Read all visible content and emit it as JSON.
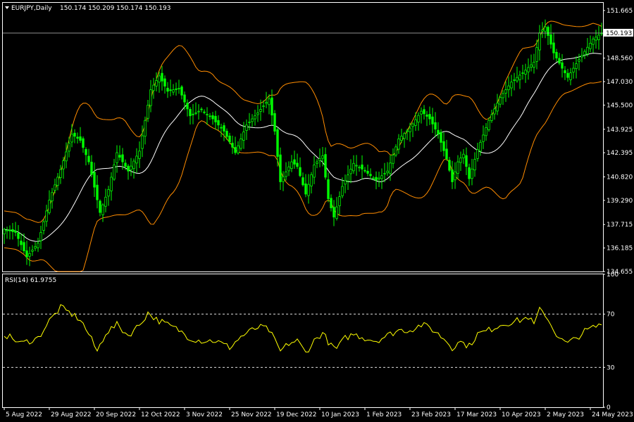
{
  "header": {
    "symbol_label": "EURJPY,Daily",
    "ohlc_text": "150.174 150.209 150.174 150.193"
  },
  "colors": {
    "background": "#000000",
    "grid": "#ffffff",
    "candle": "#00ff00",
    "bollinger": "#ff8c00",
    "sma": "#ffffff",
    "rsi": "#ffff00",
    "last_price_line": "#c0c0c0"
  },
  "chart_data": [
    {
      "type": "candlestick",
      "name": "EURJPY,Daily",
      "last_price": 150.193,
      "last_price_label": "150.193",
      "ylim": [
        134.655,
        152.165
      ],
      "y_ticks": [
        "151.665",
        "148.560",
        "147.030",
        "145.500",
        "143.925",
        "142.395",
        "140.820",
        "139.290",
        "137.715",
        "136.185",
        "134.655"
      ],
      "x_ticks": [
        "5 Aug 2022",
        "29 Aug 2022",
        "20 Sep 2022",
        "12 Oct 2022",
        "3 Nov 2022",
        "25 Nov 2022",
        "19 Dec 2022",
        "10 Jan 2023",
        "1 Feb 2023",
        "23 Feb 2023",
        "17 Mar 2023",
        "10 Apr 2023",
        "2 May 2023",
        "24 May 2023"
      ],
      "x_tick_bar_index": [
        0,
        16,
        32,
        48,
        64,
        80,
        96,
        112,
        128,
        144,
        160,
        176,
        192,
        208
      ],
      "anchors": [
        {
          "i": 0,
          "p": 137.4
        },
        {
          "i": 4,
          "p": 137.2
        },
        {
          "i": 8,
          "p": 135.6
        },
        {
          "i": 12,
          "p": 136.5
        },
        {
          "i": 16,
          "p": 139.3
        },
        {
          "i": 20,
          "p": 141.3
        },
        {
          "i": 24,
          "p": 143.6
        },
        {
          "i": 27,
          "p": 143.2
        },
        {
          "i": 30,
          "p": 141.8
        },
        {
          "i": 34,
          "p": 138.5
        },
        {
          "i": 37,
          "p": 140.0
        },
        {
          "i": 40,
          "p": 142.4
        },
        {
          "i": 44,
          "p": 141.2
        },
        {
          "i": 48,
          "p": 142.5
        },
        {
          "i": 52,
          "p": 146.5
        },
        {
          "i": 55,
          "p": 147.4
        },
        {
          "i": 58,
          "p": 146.4
        },
        {
          "i": 62,
          "p": 146.6
        },
        {
          "i": 66,
          "p": 144.8
        },
        {
          "i": 70,
          "p": 145.2
        },
        {
          "i": 74,
          "p": 144.6
        },
        {
          "i": 78,
          "p": 143.8
        },
        {
          "i": 82,
          "p": 142.4
        },
        {
          "i": 86,
          "p": 144.2
        },
        {
          "i": 90,
          "p": 145.0
        },
        {
          "i": 94,
          "p": 145.9
        },
        {
          "i": 96,
          "p": 143.8
        },
        {
          "i": 98,
          "p": 140.5
        },
        {
          "i": 102,
          "p": 141.8
        },
        {
          "i": 104,
          "p": 141.5
        },
        {
          "i": 107,
          "p": 139.7
        },
        {
          "i": 110,
          "p": 141.6
        },
        {
          "i": 113,
          "p": 142.2
        },
        {
          "i": 115,
          "p": 139.4
        },
        {
          "i": 117,
          "p": 138.2
        },
        {
          "i": 120,
          "p": 140.2
        },
        {
          "i": 124,
          "p": 141.7
        },
        {
          "i": 128,
          "p": 141.2
        },
        {
          "i": 132,
          "p": 140.6
        },
        {
          "i": 136,
          "p": 141.2
        },
        {
          "i": 140,
          "p": 143.3
        },
        {
          "i": 144,
          "p": 144.0
        },
        {
          "i": 148,
          "p": 145.1
        },
        {
          "i": 151,
          "p": 144.6
        },
        {
          "i": 154,
          "p": 143.6
        },
        {
          "i": 157,
          "p": 142.0
        },
        {
          "i": 159,
          "p": 140.5
        },
        {
          "i": 161,
          "p": 141.8
        },
        {
          "i": 163,
          "p": 142.3
        },
        {
          "i": 165,
          "p": 140.7
        },
        {
          "i": 168,
          "p": 142.6
        },
        {
          "i": 172,
          "p": 144.5
        },
        {
          "i": 176,
          "p": 146.0
        },
        {
          "i": 180,
          "p": 147.0
        },
        {
          "i": 184,
          "p": 147.6
        },
        {
          "i": 188,
          "p": 148.3
        },
        {
          "i": 190,
          "p": 150.2
        },
        {
          "i": 192,
          "p": 150.6
        },
        {
          "i": 195,
          "p": 148.9
        },
        {
          "i": 198,
          "p": 147.9
        },
        {
          "i": 200,
          "p": 147.3
        },
        {
          "i": 203,
          "p": 148.2
        },
        {
          "i": 206,
          "p": 149.0
        },
        {
          "i": 209,
          "p": 149.8
        },
        {
          "i": 212,
          "p": 150.19
        }
      ],
      "overlays": [
        {
          "kind": "sma",
          "period": 20
        },
        {
          "kind": "bollinger",
          "period": 20,
          "deviation": 2
        }
      ]
    },
    {
      "type": "line",
      "name": "RSI(14)",
      "label": "RSI(14) 61.9755",
      "ylim": [
        0,
        100
      ],
      "y_ticks": [
        "100",
        "70",
        "30",
        "0"
      ],
      "levels": [
        70,
        30
      ],
      "anchors": [
        {
          "i": 0,
          "v": 55
        },
        {
          "i": 6,
          "v": 48
        },
        {
          "i": 12,
          "v": 52
        },
        {
          "i": 16,
          "v": 65
        },
        {
          "i": 20,
          "v": 75
        },
        {
          "i": 24,
          "v": 70
        },
        {
          "i": 27,
          "v": 66
        },
        {
          "i": 30,
          "v": 55
        },
        {
          "i": 33,
          "v": 42
        },
        {
          "i": 36,
          "v": 56
        },
        {
          "i": 40,
          "v": 62
        },
        {
          "i": 44,
          "v": 54
        },
        {
          "i": 48,
          "v": 62
        },
        {
          "i": 51,
          "v": 71
        },
        {
          "i": 54,
          "v": 66
        },
        {
          "i": 58,
          "v": 62
        },
        {
          "i": 62,
          "v": 58
        },
        {
          "i": 66,
          "v": 52
        },
        {
          "i": 70,
          "v": 50
        },
        {
          "i": 75,
          "v": 50
        },
        {
          "i": 80,
          "v": 45
        },
        {
          "i": 84,
          "v": 53
        },
        {
          "i": 88,
          "v": 58
        },
        {
          "i": 90,
          "v": 60
        },
        {
          "i": 92,
          "v": 60
        },
        {
          "i": 94,
          "v": 58
        },
        {
          "i": 96,
          "v": 50
        },
        {
          "i": 98,
          "v": 42
        },
        {
          "i": 101,
          "v": 48
        },
        {
          "i": 104,
          "v": 50
        },
        {
          "i": 107,
          "v": 41
        },
        {
          "i": 110,
          "v": 50
        },
        {
          "i": 113,
          "v": 56
        },
        {
          "i": 116,
          "v": 46
        },
        {
          "i": 118,
          "v": 44
        },
        {
          "i": 121,
          "v": 52
        },
        {
          "i": 124,
          "v": 55
        },
        {
          "i": 128,
          "v": 52
        },
        {
          "i": 132,
          "v": 50
        },
        {
          "i": 136,
          "v": 54
        },
        {
          "i": 140,
          "v": 58
        },
        {
          "i": 144,
          "v": 58
        },
        {
          "i": 148,
          "v": 62
        },
        {
          "i": 151,
          "v": 60
        },
        {
          "i": 154,
          "v": 55
        },
        {
          "i": 157,
          "v": 50
        },
        {
          "i": 159,
          "v": 44
        },
        {
          "i": 161,
          "v": 50
        },
        {
          "i": 163,
          "v": 48
        },
        {
          "i": 165,
          "v": 46
        },
        {
          "i": 168,
          "v": 55
        },
        {
          "i": 172,
          "v": 58
        },
        {
          "i": 176,
          "v": 62
        },
        {
          "i": 180,
          "v": 64
        },
        {
          "i": 184,
          "v": 66
        },
        {
          "i": 186,
          "v": 68
        },
        {
          "i": 188,
          "v": 62
        },
        {
          "i": 190,
          "v": 73
        },
        {
          "i": 192,
          "v": 70
        },
        {
          "i": 194,
          "v": 62
        },
        {
          "i": 196,
          "v": 55
        },
        {
          "i": 198,
          "v": 50
        },
        {
          "i": 200,
          "v": 48
        },
        {
          "i": 203,
          "v": 52
        },
        {
          "i": 206,
          "v": 57
        },
        {
          "i": 209,
          "v": 60
        },
        {
          "i": 212,
          "v": 61.98
        }
      ]
    }
  ]
}
